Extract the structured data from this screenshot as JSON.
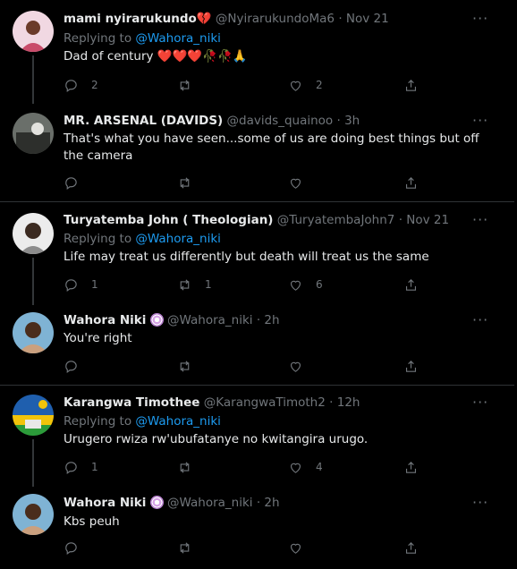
{
  "tweets": [
    {
      "name": "mami nyirarukundo💔",
      "handle": "@NyirarukundoMa6",
      "time": "Nov 21",
      "replying_label": "Replying to",
      "replying_to": "@Wahora_niki",
      "text": "Dad of century ❤️❤️❤️🥀🥀🙏",
      "replies": "2",
      "retweets": "",
      "likes": "2",
      "avatar_colors": [
        "#f3d6e0",
        "#b7475f"
      ]
    },
    {
      "name": "MR. ARSENAL (DAVIDS)",
      "handle": "@davids_quainoo",
      "time": "3h",
      "text": "That's what you have seen...some of us are doing best things but off the camera",
      "replies": "",
      "retweets": "",
      "likes": "",
      "avatar_colors": [
        "#3a3f3a",
        "#c8c8c4"
      ]
    },
    {
      "name": "Turyatemba John ( Theologian)",
      "handle": "@TuryatembaJohn7",
      "time": "Nov 21",
      "replying_label": "Replying to",
      "replying_to": "@Wahora_niki",
      "text": "Life may treat us differently but death will treat us the same",
      "replies": "1",
      "retweets": "1",
      "likes": "6",
      "avatar_colors": [
        "#e9e9ea",
        "#3a2a20"
      ]
    },
    {
      "name": "Wahora Niki",
      "handle": "@Wahora_niki",
      "time": "2h",
      "text": "You're right",
      "replies": "",
      "retweets": "",
      "likes": "",
      "avatar_colors": [
        "#6ea9cf",
        "#3a2418"
      ]
    },
    {
      "name": "Karangwa Timothee",
      "handle": "@KarangwaTimoth2",
      "time": "12h",
      "replying_label": "Replying to",
      "replying_to": "@Wahora_niki",
      "text": "Urugero rwiza rw'ubufatanye no kwitangira urugo.",
      "replies": "1",
      "retweets": "",
      "likes": "4",
      "avatar_colors": [
        "#1f5fae",
        "#f2c40b",
        "#2c9b3a"
      ]
    },
    {
      "name": "Wahora Niki",
      "handle": "@Wahora_niki",
      "time": "2h",
      "text": "Kbs peuh",
      "replies": "",
      "retweets": "",
      "likes": "",
      "avatar_colors": [
        "#6ea9cf",
        "#3a2418"
      ]
    }
  ],
  "icons": {
    "reply": "speech-bubble-icon",
    "retweet": "retweet-icon",
    "like": "heart-icon",
    "share": "share-icon",
    "more": "more-dots-icon",
    "verified_badge": "badge-icon"
  },
  "colors": {
    "background": "#000000",
    "text": "#e7e9ea",
    "muted": "#71767b",
    "link": "#1d9bf0",
    "divider": "#2f3336"
  }
}
